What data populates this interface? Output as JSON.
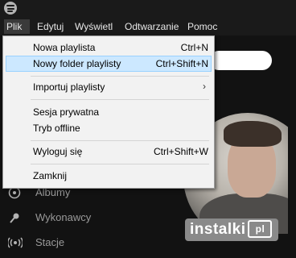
{
  "app": {
    "logo_icon": "spotify-logo-icon"
  },
  "menubar": {
    "items": [
      {
        "label": "Plik",
        "active": true
      },
      {
        "label": "Edytuj"
      },
      {
        "label": "Wyświetl"
      },
      {
        "label": "Odtwarzanie"
      },
      {
        "label": "Pomoc"
      }
    ]
  },
  "file_menu": {
    "items": [
      {
        "label": "Nowa playlista",
        "shortcut": "Ctrl+N"
      },
      {
        "label": "Nowy folder playlisty",
        "shortcut": "Ctrl+Shift+N",
        "highlighted": true
      },
      {
        "label": "Importuj playlisty",
        "submenu": "›"
      },
      {
        "label": "Sesja prywatna"
      },
      {
        "label": "Tryb offline"
      },
      {
        "label": "Wyloguj się",
        "shortcut": "Ctrl+Shift+W"
      },
      {
        "label": "Zamknij"
      }
    ]
  },
  "sidebar": {
    "items": [
      {
        "label": "Albumy",
        "icon": "disc-icon"
      },
      {
        "label": "Wykonawcy",
        "icon": "microphone-icon"
      },
      {
        "label": "Stacje",
        "icon": "radio-icon"
      }
    ]
  },
  "watermark": {
    "text": "instalki",
    "badge": "pl"
  },
  "colors": {
    "background": "#121212",
    "menubar": "#1a1a1a",
    "menu_bg": "#f2f2f2",
    "highlight": "#cce8ff",
    "highlight_border": "#99d1ff"
  }
}
